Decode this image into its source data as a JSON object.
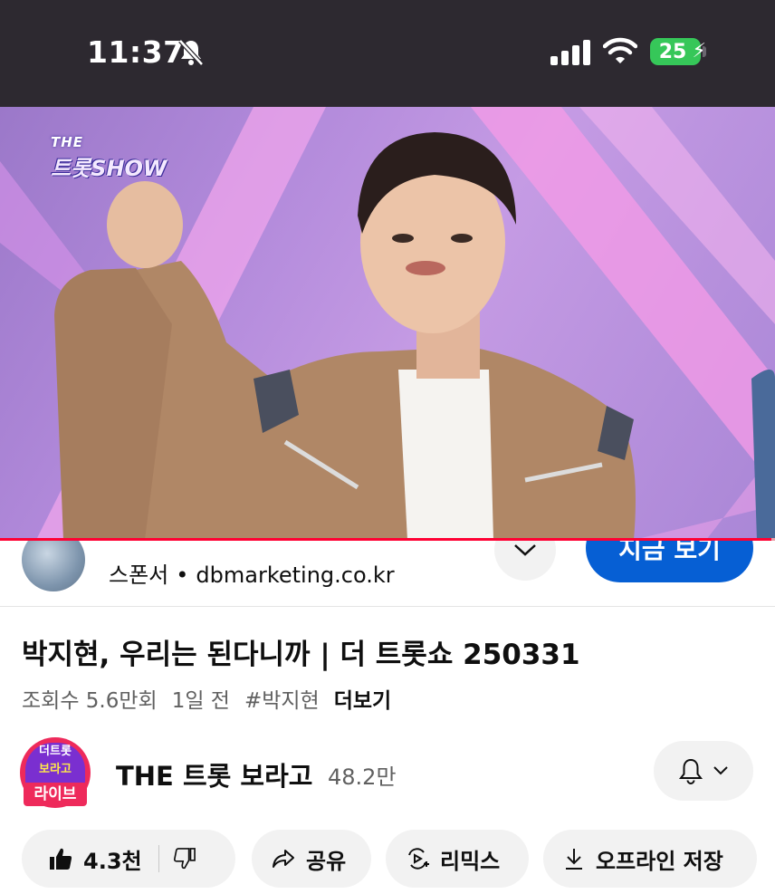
{
  "status_bar": {
    "time": "11:37",
    "battery": "25"
  },
  "video": {
    "show_logo_top": "THE",
    "show_logo_bottom": "트롯SHOW",
    "progress_fraction": 0.995
  },
  "sponsor": {
    "label": "스폰서",
    "domain": "dbmarketing.co.kr",
    "cta_label": "지금 보기"
  },
  "video_info": {
    "title": "박지현, 우리는 된다니까 | 더 트롯쇼 250331",
    "views": "조회수 5.6만회",
    "age": "1일 전",
    "hashtag": "#박지현",
    "more_label": "더보기"
  },
  "channel": {
    "avatar_text_top": "더트롯",
    "avatar_text_bottom": "보라고",
    "live_badge": "라이브",
    "name": "THE 트롯 보라고",
    "subscribers": "48.2만"
  },
  "actions": {
    "like_count": "4.3천",
    "share_label": "공유",
    "remix_label": "리믹스",
    "offline_label": "오프라인 저장"
  },
  "colors": {
    "accent_blue": "#065fd4",
    "progress_red": "#ff0033",
    "battery_green": "#36c759",
    "live_pink": "#ee2a5b"
  }
}
